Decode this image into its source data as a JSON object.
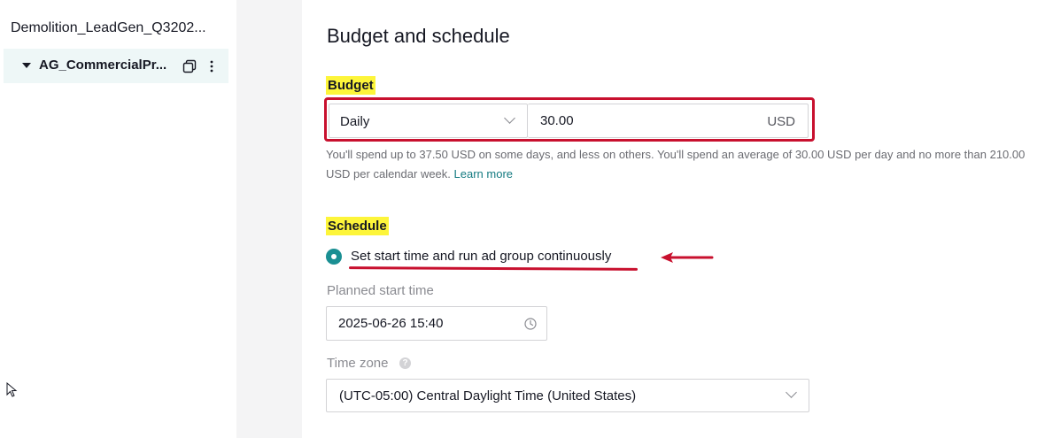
{
  "sidebar": {
    "campaign_name": "Demolition_LeadGen_Q3202...",
    "adgroup_name": "AG_CommercialPr...",
    "icons": [
      "caret-down-icon",
      "copy-icon",
      "more-vertical-icon"
    ]
  },
  "main": {
    "section_title": "Budget and schedule",
    "budget": {
      "label": "Budget",
      "type_value": "Daily",
      "amount_value": "30.00",
      "currency": "USD",
      "helper_text": "You'll spend up to 37.50 USD on some days, and less on others. You'll spend an average of 30.00 USD per day and no more than 210.00 USD per calendar week.",
      "learn_more": "Learn more"
    },
    "schedule": {
      "label": "Schedule",
      "option_label": "Set start time and run ad group continuously",
      "option_selected": true,
      "start_time_label": "Planned start time",
      "start_time_value": "2025-06-26 15:40",
      "timezone_label": "Time zone",
      "timezone_value": "(UTC-05:00) Central Daylight Time (United States)"
    }
  },
  "colors": {
    "accent": "#1a8f93",
    "annotation_red": "#c8102e",
    "highlight_yellow": "#fdf53a",
    "link": "#137a80"
  }
}
